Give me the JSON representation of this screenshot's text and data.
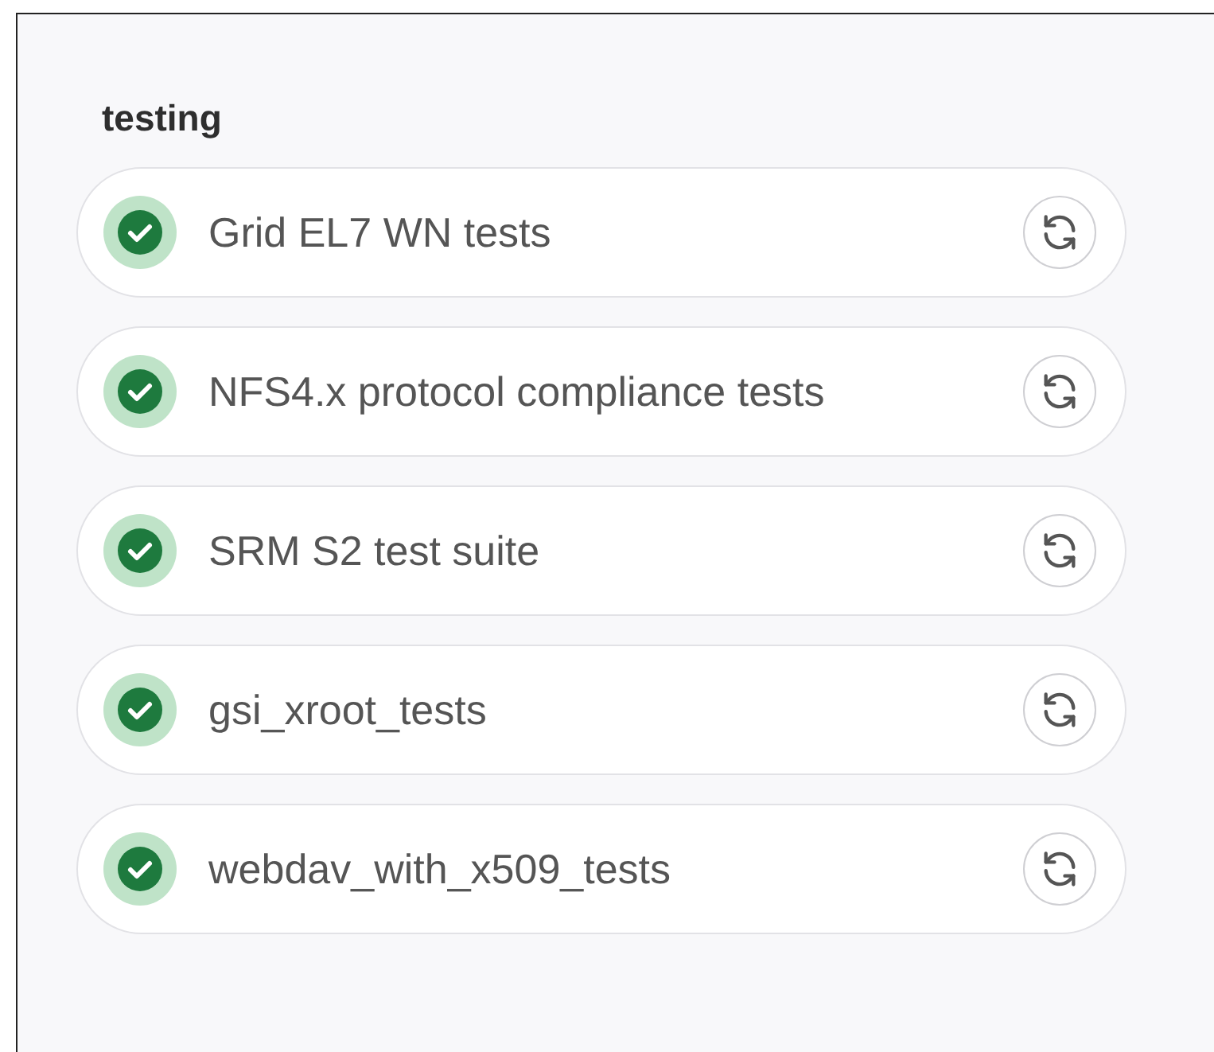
{
  "section": {
    "title": "testing",
    "items": [
      {
        "name": "Grid EL7 WN tests",
        "kind": "passed"
      },
      {
        "name": "NFS4.x protocol compliance tests",
        "kind": "passed"
      },
      {
        "name": "SRM S2 test suite",
        "kind": "passed"
      },
      {
        "name": "gsi_xroot_tests",
        "kind": "passed"
      },
      {
        "name": "webdav_with_x509_tests",
        "kind": "passed"
      }
    ]
  }
}
